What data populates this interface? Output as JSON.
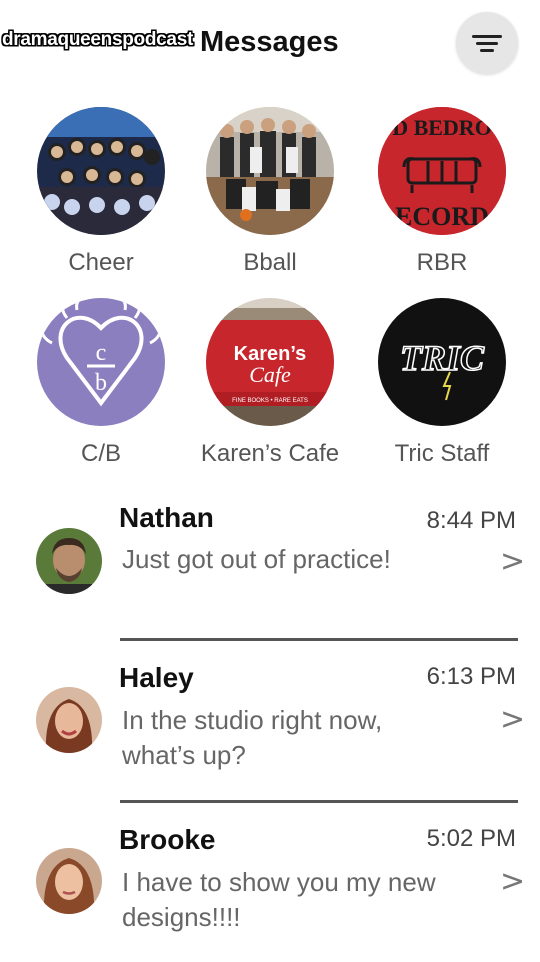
{
  "watermark": "dramaqueenspodcast",
  "header": {
    "title": "Messages"
  },
  "groups": [
    {
      "label": "Cheer"
    },
    {
      "label": "Bball"
    },
    {
      "label": "RBR",
      "art_text_top": "D BEDRO",
      "art_text_bottom": "ECORD"
    },
    {
      "label": "C/B",
      "art_text_top": "c",
      "art_text_bottom": "b"
    },
    {
      "label": "Karen’s Cafe",
      "art_text_top": "Karen’s",
      "art_text_mid": "Cafe",
      "art_text_bottom": "FINE BOOKS  •  RARE EATS"
    },
    {
      "label": "Tric Staff",
      "art_text": "TRIC"
    }
  ],
  "conversations": [
    {
      "name": "Nathan",
      "time": "8:44 PM",
      "message": "Just got out of practice!"
    },
    {
      "name": "Haley",
      "time": "6:13 PM",
      "message": "In the studio right now, what’s up?"
    },
    {
      "name": "Brooke",
      "time": "5:02 PM",
      "message": "I have to show you my new designs!!!!"
    }
  ],
  "chevron": ">",
  "colors": {
    "accent_red": "#c7262c",
    "cb_purple": "#8b7fc0",
    "tric_black": "#111111"
  }
}
